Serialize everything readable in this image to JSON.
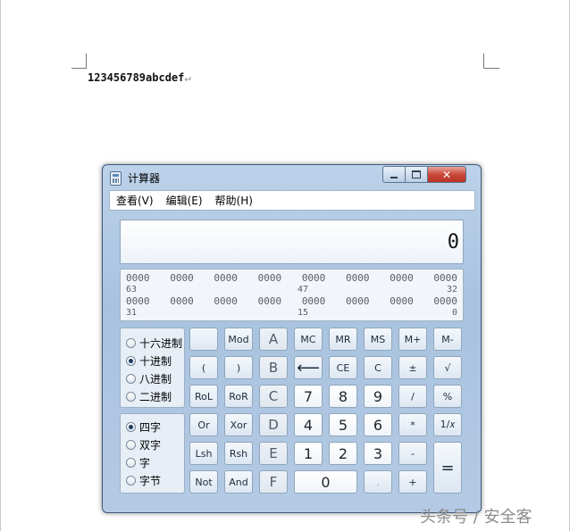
{
  "document": {
    "text": "123456789abcdef",
    "paragraph_mark": "↵"
  },
  "calculator": {
    "title": "计算器",
    "window_buttons": {
      "close": "✕"
    },
    "menu": [
      "查看(V)",
      "编辑(E)",
      "帮助(H)"
    ],
    "display": {
      "value": "0"
    },
    "bits": {
      "row1": [
        "0000",
        "0000",
        "0000",
        "0000",
        "0000",
        "0000",
        "0000",
        "0000"
      ],
      "row1_labels": [
        "63",
        "47",
        "32"
      ],
      "row2": [
        "0000",
        "0000",
        "0000",
        "0000",
        "0000",
        "0000",
        "0000",
        "0000"
      ],
      "row2_labels": [
        "31",
        "15",
        "0"
      ]
    },
    "base_options": [
      {
        "label": "十六进制",
        "selected": false
      },
      {
        "label": "十进制",
        "selected": true
      },
      {
        "label": "八进制",
        "selected": false
      },
      {
        "label": "二进制",
        "selected": false
      }
    ],
    "word_options": [
      {
        "label": "四字",
        "selected": true
      },
      {
        "label": "双字",
        "selected": false
      },
      {
        "label": "字",
        "selected": false
      },
      {
        "label": "字节",
        "selected": false
      }
    ],
    "keys": {
      "blank": "",
      "mod": "Mod",
      "a": "A",
      "mc": "MC",
      "mr": "MR",
      "ms": "MS",
      "mplus": "M+",
      "mminus": "M-",
      "lparen": "(",
      "rparen": ")",
      "b": "B",
      "backspace": "⟵",
      "ce": "CE",
      "c": "C",
      "plusminus": "±",
      "sqrt": "√",
      "rol": "RoL",
      "ror": "RoR",
      "hexc": "C",
      "seven": "7",
      "eight": "8",
      "nine": "9",
      "divide": "/",
      "percent": "%",
      "or": "Or",
      "xor": "Xor",
      "d": "D",
      "four": "4",
      "five": "5",
      "six": "6",
      "multiply": "*",
      "reciprocal": "1/𝑥",
      "lsh": "Lsh",
      "rsh": "Rsh",
      "e": "E",
      "one": "1",
      "two": "2",
      "three": "3",
      "minus": "-",
      "equals": "=",
      "not": "Not",
      "and": "And",
      "f": "F",
      "zero": "0",
      "decimal": ".",
      "plus": "+"
    }
  },
  "watermark": "头条号 / 安全客"
}
